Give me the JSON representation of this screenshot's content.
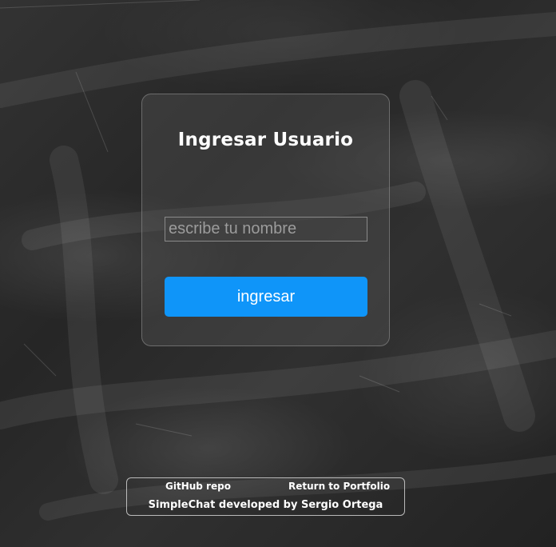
{
  "login": {
    "title": "Ingresar Usuario",
    "name_placeholder": "escribe tu nombre",
    "name_value": "",
    "submit_label": "ingresar"
  },
  "footer": {
    "github_label": "GitHub repo",
    "portfolio_label": "Return to Portfolio",
    "credit": "SimpleChat developed by Sergio Ortega"
  },
  "colors": {
    "accent": "#0f95f9",
    "background": "#2b2b2b",
    "text": "#ffffff"
  }
}
